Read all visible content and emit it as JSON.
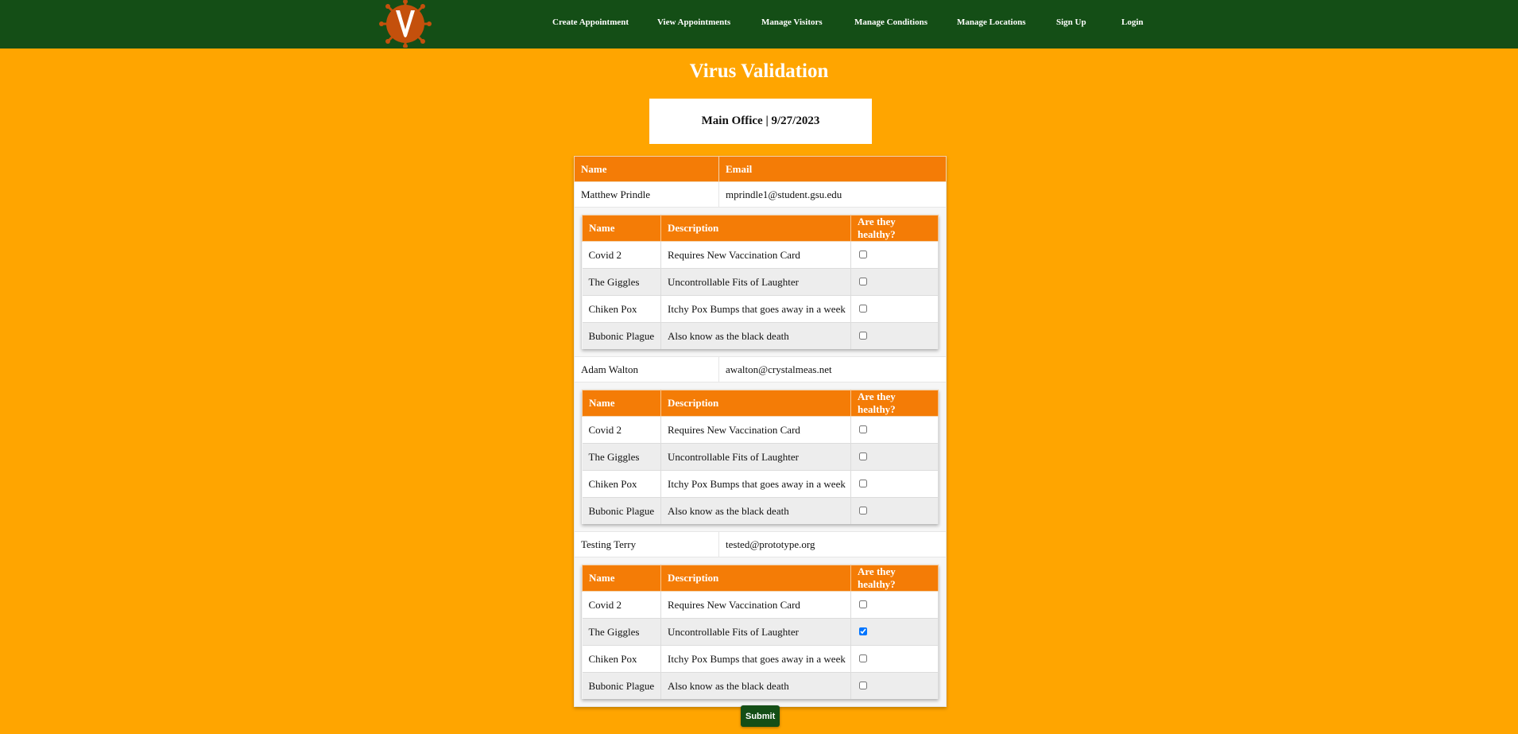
{
  "nav": {
    "logo_icon": "virus-v-logo-icon",
    "links": [
      "Create Appointment",
      "View Appointments",
      "Manage Visitors",
      "Manage Conditions",
      "Manage Locations",
      "Sign Up",
      "Login"
    ]
  },
  "page": {
    "title": "Virus Validation",
    "office_header": "Main Office | 9/27/2023"
  },
  "visitor_table": {
    "headers": [
      "Name",
      "Email"
    ],
    "condition_headers": [
      "Name",
      "Description",
      "Are they healthy?"
    ],
    "visitors": [
      {
        "name": "Matthew Prindle",
        "email": "mprindle1@student.gsu.edu",
        "conditions": [
          {
            "name": "Covid 2",
            "description": "Requires New Vaccination Card",
            "healthy": false
          },
          {
            "name": "The Giggles",
            "description": "Uncontrollable Fits of Laughter",
            "healthy": false
          },
          {
            "name": "Chiken Pox",
            "description": "Itchy Pox Bumps that goes away in a week",
            "healthy": false
          },
          {
            "name": "Bubonic Plague",
            "description": "Also know as the black death",
            "healthy": false
          }
        ]
      },
      {
        "name": "Adam Walton",
        "email": "awalton@crystalmeas.net",
        "conditions": [
          {
            "name": "Covid 2",
            "description": "Requires New Vaccination Card",
            "healthy": false
          },
          {
            "name": "The Giggles",
            "description": "Uncontrollable Fits of Laughter",
            "healthy": false
          },
          {
            "name": "Chiken Pox",
            "description": "Itchy Pox Bumps that goes away in a week",
            "healthy": false
          },
          {
            "name": "Bubonic Plague",
            "description": "Also know as the black death",
            "healthy": false
          }
        ]
      },
      {
        "name": "Testing Terry",
        "email": "tested@prototype.org",
        "conditions": [
          {
            "name": "Covid 2",
            "description": "Requires New Vaccination Card",
            "healthy": false
          },
          {
            "name": "The Giggles",
            "description": "Uncontrollable Fits of Laughter",
            "healthy": true
          },
          {
            "name": "Chiken Pox",
            "description": "Itchy Pox Bumps that goes away in a week",
            "healthy": false
          },
          {
            "name": "Bubonic Plague",
            "description": "Also know as the black death",
            "healthy": false
          }
        ]
      }
    ]
  },
  "submit_label": "Submit",
  "colors": {
    "nav_bg": "#144E16",
    "page_bg": "#FFA500",
    "table_header": "#F47C06",
    "logo_fill": "#C4500C"
  }
}
